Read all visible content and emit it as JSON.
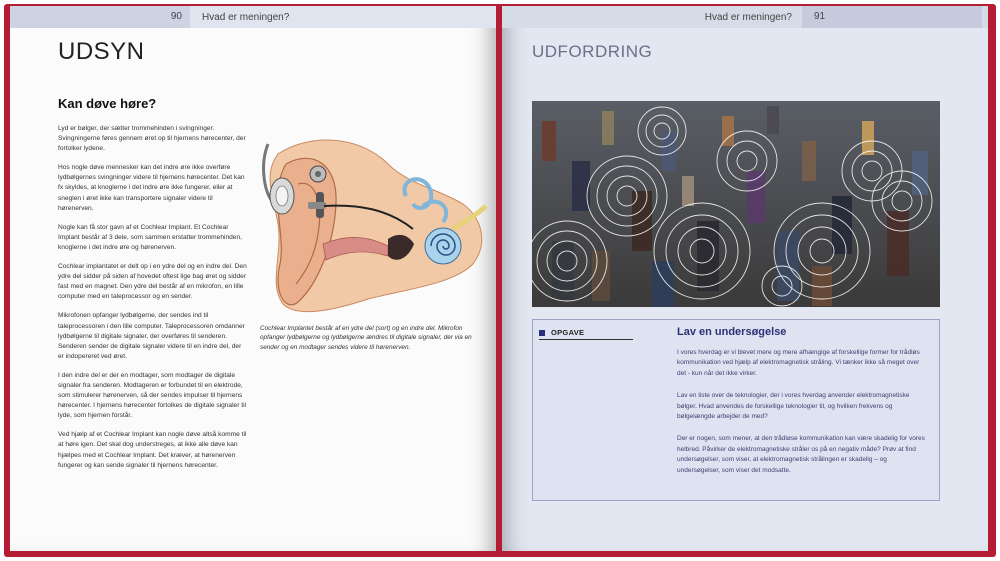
{
  "left_page": {
    "page_number": "90",
    "running_head": "Hvad er meningen?",
    "section_title": "UDSYN",
    "subheading": "Kan døve høre?",
    "paragraphs": [
      "Lyd er bølger, der sætter trommehinden i svingninger. Svingningerne føres gennem øret op til hjernens hørecenter, der fortolker lydene.",
      "Hos nogle døve mennesker kan det indre øre ikke overføre lydbølgernes svingninger videre til hjernens hørecenter. Det kan fx skyldes, at knoglerne i det indre øre ikke fungerer, eller at sneglen i øret ikke kan transportere signaler videre til hørenerven.",
      "Nogle kan få stor gavn af et Cochlear Implant. Et Cochlear Implant består af 3 dele, som sammen erstatter trommehinden, knoglerne i det indre øre og hørenerven.",
      "Cochlear implantatet er delt op i en ydre del og en indre del. Den ydre del sidder på siden af hovedet oftest lige bag øret og sidder fast med en magnet. Den ydre del består af en mikrofon, en lille computer med en taleprocessor og en sender.",
      "Mikrofonen opfanger lydbølgerne, der sendes ind til taleprocessoren i den lille computer. Taleprocessoren omdanner lydbølgerne til digitale signaler, der overføres til senderen. Senderen sender de digitale signaler videre til en indre del, der er indopereret ved øret.",
      "I den indre del er der en modtager, som modtager de digitale signaler fra senderen. Modtageren er forbundet til en elektrode, som stimulerer hørenerven, så der sendes impulser til hjernens hørecenter. I hjernens hørecenter fortolkes de digitale signaler til lyde, som hjernen forstår.",
      "Ved hjælp af et Cochlear Implant kan nogle døve altså komme til at høre igen. Det skal dog understreges, at ikke alle døve kan hjælpes med et Cochlear Implant. Det kræver, at hørenerven fungerer og kan sende signaler til hjernens hørecenter."
    ],
    "figure_caption": "Cochlear Implantet består af en ydre del (sort) og en indre del. Mikrofon opfanger lydbølgerne og lydbølgerne ændres til digitale signaler, der via en sender og en modtager sendes videre til hørenerven."
  },
  "right_page": {
    "page_number": "91",
    "running_head": "Hvad er meningen?",
    "section_title": "UDFORDRING",
    "task": {
      "label": "OPGAVE",
      "title": "Lav en undersøgelse",
      "paragraphs": [
        "I vores hverdag er vi blevet mere og mere afhængige af forskellige former for trådløs kommunikation ved hjælp af elektromagnetisk stråling. Vi tænker ikke så meget over det - kun når det ikke virker.",
        "Lav en liste over de teknologier, der i vores hverdag anvender elektromagnetiske bølger. Hvad anvendes de forskellige teknologier til, og hvilken frekvens og bølgelængde arbejder de med?",
        "Der er nogen, som mener, at den trådløse kommunikation kan være skadelig for vores helbred. Påvirker de elektromagnetiske stråler os på en negativ måde? Prøv at find undersøgelser, som viser, at elektromagnetisk strålingen er skadelig – og undersøgelser, som viser det modsatte."
      ]
    }
  },
  "colors": {
    "cover": "#b51d35",
    "task_title": "#2a3175",
    "right_page_bg": "#e3e7f2"
  }
}
